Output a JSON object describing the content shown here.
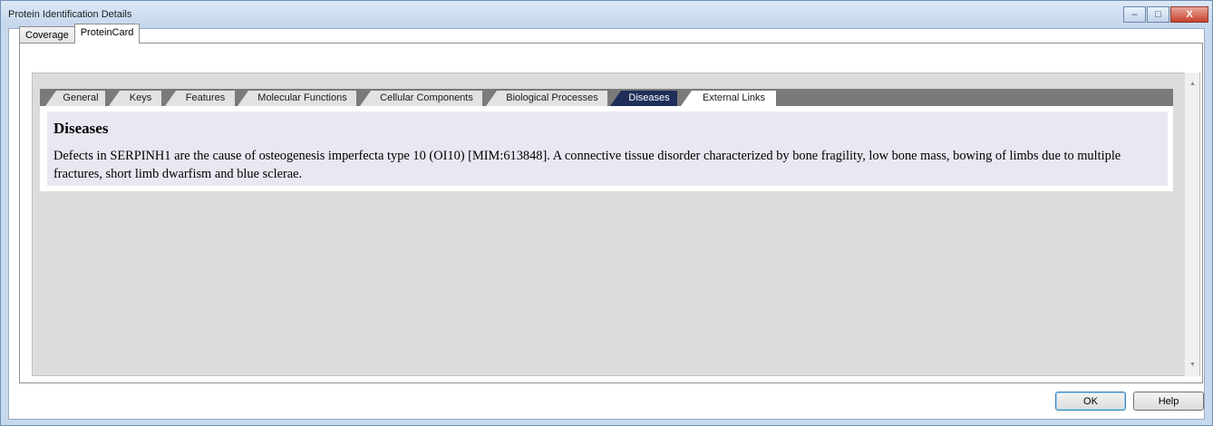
{
  "window": {
    "title": "Protein Identification Details",
    "caption_buttons": {
      "minimize": "–",
      "maximize": "□",
      "close": "X"
    }
  },
  "outer_tabs": [
    {
      "label": "Coverage",
      "active": false
    },
    {
      "label": "ProteinCard",
      "active": true
    }
  ],
  "inner_tabs": [
    {
      "label": "General",
      "active": false
    },
    {
      "label": "Keys",
      "active": false
    },
    {
      "label": "Features",
      "active": false
    },
    {
      "label": "Molecular Functions",
      "active": false
    },
    {
      "label": "Cellular Components",
      "active": false
    },
    {
      "label": "Biological Processes",
      "active": false
    },
    {
      "label": "Diseases",
      "active": true
    },
    {
      "label": "External Links",
      "active": false
    }
  ],
  "content": {
    "title": "Diseases",
    "body": "Defects in SERPINH1 are the cause of osteogenesis imperfecta type 10 (OI10) [MIM:613848]. A connective tissue disorder characterized by bone fragility, low bone mass, bowing of limbs due to multiple fractures, short limb dwarfism and blue sclerae."
  },
  "scrollbar": {
    "up": "▲",
    "down": "▼"
  },
  "buttons": {
    "ok": "OK",
    "help": "Help"
  },
  "colors": {
    "active_tab": "#1f2f5a",
    "tab_strip": "#7a7a7a",
    "content_bg": "#e8e8f2"
  }
}
